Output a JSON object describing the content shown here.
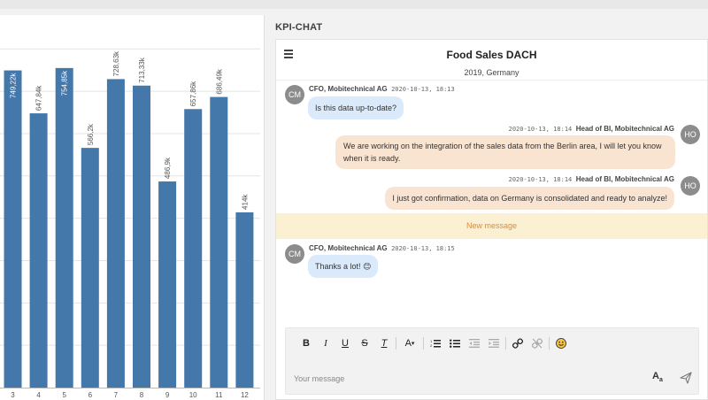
{
  "chart_data": {
    "type": "bar",
    "categories": [
      "3",
      "4",
      "5",
      "6",
      "7",
      "8",
      "9",
      "10",
      "11",
      "12"
    ],
    "values": [
      749.22,
      647.84,
      754.85,
      566.2,
      728.63,
      713.33,
      486.9,
      657.86,
      686.49,
      414
    ],
    "data_labels": [
      "749,22k",
      "647,84k",
      "754,85k",
      "566,2k",
      "728,63k",
      "713,33k",
      "486,9k",
      "657,86k",
      "686,49k",
      "414k"
    ],
    "ylim": [
      0,
      880
    ],
    "bar_color": "#4477aa",
    "grid": true
  },
  "panel": {
    "title": "KPI-CHAT"
  },
  "chat": {
    "title": "Food Sales DACH",
    "subtitle": "2019, Germany",
    "messages": [
      {
        "initials": "CM",
        "author": "CFO, Mobitechnical AG",
        "time": "2020-10-13, 18:13",
        "text": "Is this data up-to-date?"
      },
      {
        "initials": "HO",
        "author": "Head of BI, Mobitechnical AG",
        "time": "2020-10-13, 18:14",
        "text_line1": "We are working on the integration of the sales data from the Berlin area, I will let you know",
        "text_line2": "when it is ready."
      },
      {
        "initials": "HO",
        "author": "Head of BI, Mobitechnical AG",
        "time": "2020-10-13, 18:14",
        "text": "I just got confirmation, data on Germany is consolidated and ready to analyze!"
      },
      {
        "initials": "CM",
        "author": "CFO, Mobitechnical AG",
        "time": "2020-10-13, 18:15",
        "text": "Thanks a lot! 😊"
      }
    ],
    "new_message_label": "New message",
    "composer": {
      "placeholder": "Your message",
      "toolbar": {
        "bold": "B",
        "italic": "I",
        "underline": "U",
        "strike": "S",
        "clear": "T",
        "font_size": "A",
        "emoji": "☺"
      }
    },
    "colors": {
      "incoming": "#dbeafb",
      "outgoing": "#f9e4d2",
      "new_message_bg": "#fbf1d2",
      "new_message_text": "#e08a3a"
    }
  }
}
